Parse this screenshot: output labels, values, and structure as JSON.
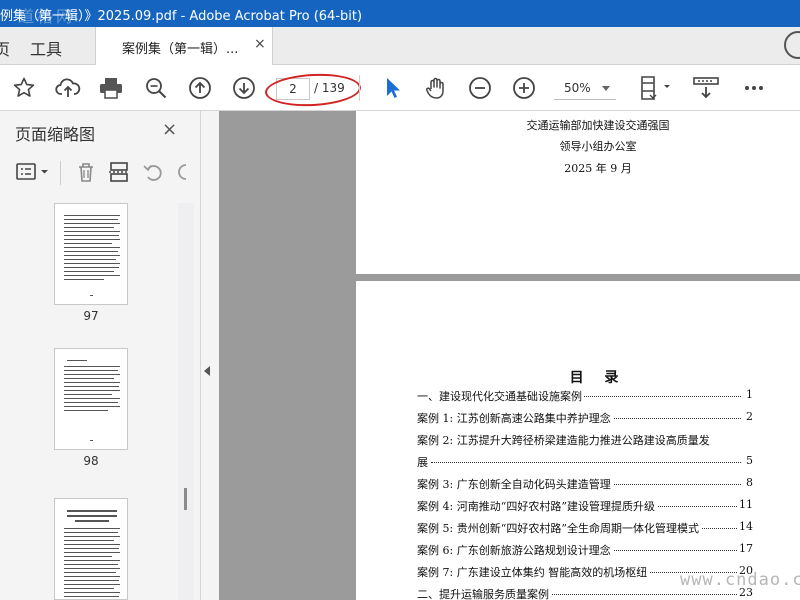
{
  "window": {
    "title": "例集（第一辑）》2025.09.pdf - Adobe Acrobat Pro (64-bit)",
    "watermark_top": "道格网"
  },
  "tabbar": {
    "home_label": "页",
    "tools_label": "工具",
    "doc_tab_label": "案例集（第一辑）...",
    "close_glyph": "×"
  },
  "toolbar": {
    "current_page": "2",
    "total_pages": "/ 139",
    "zoom": "50%",
    "icons": [
      "star-icon",
      "cloud-upload-icon",
      "print-icon",
      "search-zoom-icon",
      "page-up-icon",
      "page-down-icon",
      "select-pointer-icon",
      "hand-icon",
      "zoom-out-icon",
      "zoom-in-icon",
      "page-fit-icon",
      "scroll-mode-icon",
      "more-icon"
    ]
  },
  "sidebar": {
    "title": "页面缩略图",
    "close_glyph": "×",
    "thumbnails": [
      {
        "page": "97"
      },
      {
        "page": "98"
      },
      {
        "page": ""
      }
    ]
  },
  "document": {
    "page1_lines": [
      "交通运输部加快建设交通强国",
      "领导小组办公室",
      "2025 年 9 月"
    ],
    "toc_title": "目 录",
    "toc": [
      {
        "text": "一、建设现代化交通基础设施案例",
        "page": "1"
      },
      {
        "text": "案例 1:  江苏创新高速公路集中养护理念",
        "page": "2"
      },
      {
        "text": "案例 2:  江苏提升大跨径桥梁建造能力推进公路建设高质量发",
        "page": ""
      },
      {
        "text": "展",
        "page": "5"
      },
      {
        "text": "案例 3:  广东创新全自动化码头建造管理",
        "page": "8"
      },
      {
        "text": "案例 4:  河南推动“四好农村路”建设管理提质升级",
        "page": "11"
      },
      {
        "text": "案例 5:  贵州创新“四好农村路”全生命周期一体化管理模式",
        "page": "14"
      },
      {
        "text": "案例 6:  广东创新旅游公路规划设计理念",
        "page": "17"
      },
      {
        "text": "案例 7:  广东建设立体集约 智能高效的机场枢纽",
        "page": "20"
      },
      {
        "text": "二、提升运输服务质量案例",
        "page": "23"
      }
    ]
  },
  "watermark_bottom": "www.cndao.com",
  "colors": {
    "titlebar": "#1565c0",
    "annotation_circle": "#d32222",
    "select_icon": "#1a6fd6"
  }
}
